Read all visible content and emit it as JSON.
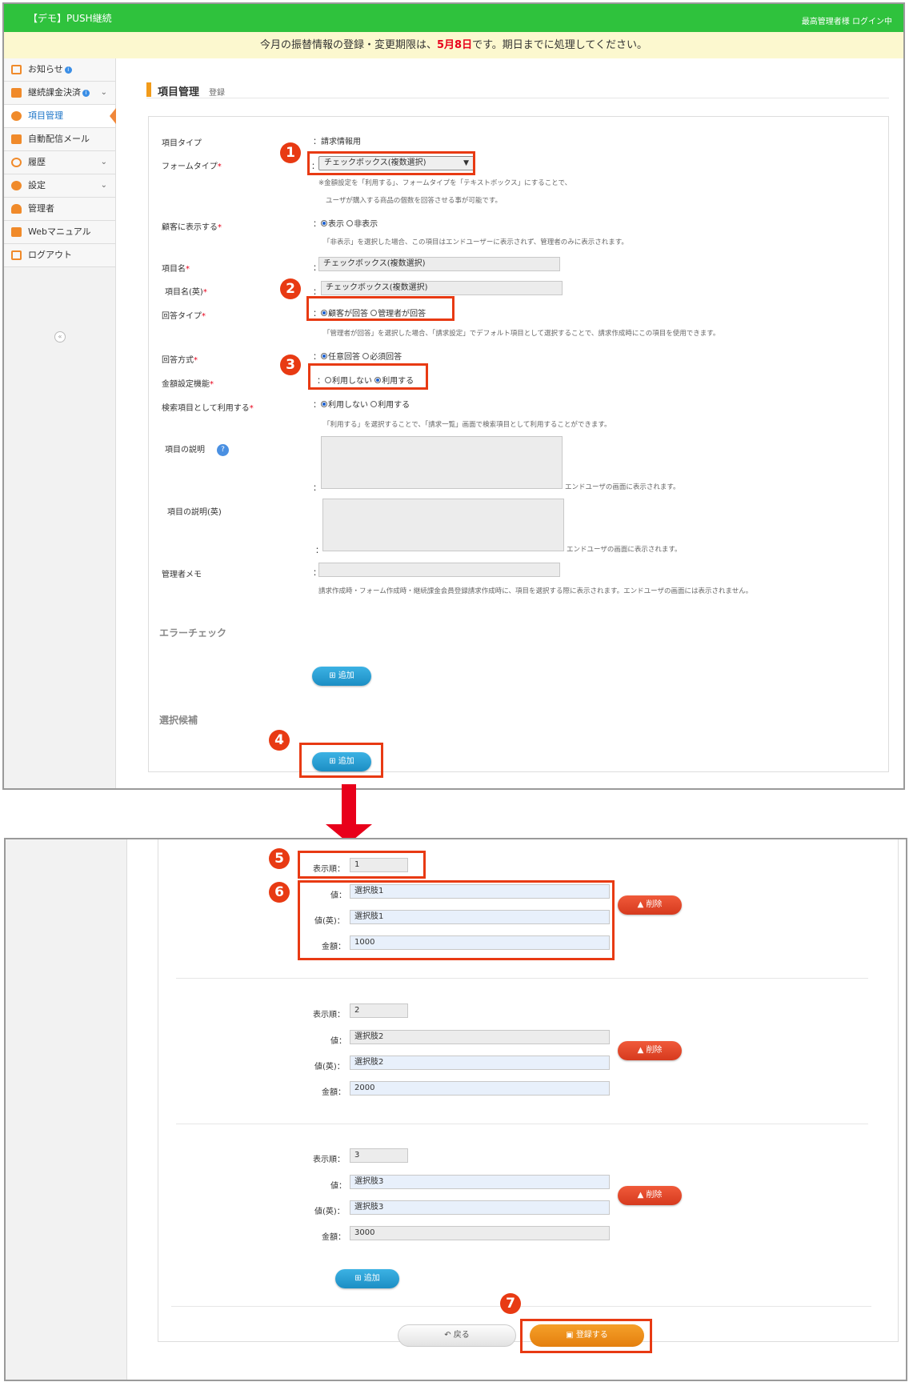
{
  "header": {
    "title": "【デモ】PUSH継続",
    "login": "最高管理者様 ログイン中"
  },
  "notice": {
    "before": "今月の振替情報の登録・変更期限は、",
    "date": "5月8日",
    "after": "です。期日までに処理してください。"
  },
  "sidebar": {
    "items": [
      {
        "label": "お知らせ",
        "icon": "chart-icon",
        "color": "#f08a2a"
      },
      {
        "label": "継続課金決済",
        "icon": "card-icon",
        "color": "#f08a2a"
      },
      {
        "label": "項目管理",
        "icon": "cubes-icon",
        "color": "#f08a2a"
      },
      {
        "label": "自動配信メール",
        "icon": "mail-icon",
        "color": "#f08a2a"
      },
      {
        "label": "履歴",
        "icon": "history-icon",
        "color": "#f08a2a"
      },
      {
        "label": "設定",
        "icon": "gears-icon",
        "color": "#f08a2a"
      },
      {
        "label": "管理者",
        "icon": "user-icon",
        "color": "#f08a2a"
      },
      {
        "label": "Webマニュアル",
        "icon": "book-icon",
        "color": "#f08a2a"
      },
      {
        "label": "ログアウト",
        "icon": "logout-icon",
        "color": "#f08a2a"
      }
    ],
    "info_mark": "i"
  },
  "page": {
    "title": "項目管理",
    "subtitle": "登録"
  },
  "form": {
    "item_type": {
      "label": "項目タイプ",
      "value": "：請求情報用"
    },
    "form_type": {
      "label": "フォームタイプ",
      "value": "チェックボックス(複数選択)",
      "note1": "※金額設定を「利用する」、フォームタイプを「テキストボックス」にすることで、",
      "note2": "ユーザが購入する商品の個数を回答させる事が可能です。"
    },
    "display": {
      "label": "顧客に表示する",
      "opt1": "表示",
      "opt2": "非表示",
      "note": "「非表示」を選択した場合、この項目はエンドユーザーに表示されず、管理者のみに表示されます。"
    },
    "name": {
      "label": "項目名",
      "value": "チェックボックス(複数選択)"
    },
    "name_en": {
      "label": "項目名(英)",
      "value": "チェックボックス(複数選択)"
    },
    "answer_type": {
      "label": "回答タイプ",
      "opt1": "顧客が回答",
      "opt2": "管理者が回答",
      "note": "「管理者が回答」を選択した場合、「請求設定」でデフォルト項目として選択することで、請求作成時にこの項目を使用できます。"
    },
    "answer_method": {
      "label": "回答方式",
      "opt1": "任意回答",
      "opt2": "必須回答"
    },
    "amount": {
      "label": "金額設定機能",
      "opt1": "利用しない",
      "opt2": "利用する"
    },
    "search": {
      "label": "検索項目として利用する",
      "opt1": "利用しない",
      "opt2": "利用する",
      "note": "「利用する」を選択することで、「請求一覧」画面で検索項目として利用することができます。"
    },
    "desc": {
      "label": "項目の説明",
      "note": "エンドユーザの画面に表示されます。",
      "help": "?"
    },
    "desc_en": {
      "label": "項目の説明(英)",
      "note": "エンドユーザの画面に表示されます。"
    },
    "memo": {
      "label": "管理者メモ",
      "note": "請求作成時・フォーム作成時・継続課金会員登録請求作成時に、項目を選択する際に表示されます。エンドユーザの画面には表示されません。"
    },
    "colon": "：",
    "req": "*"
  },
  "error_check": {
    "title": "エラーチェック",
    "add": "追加"
  },
  "choices": {
    "title": "選択候補",
    "add": "追加"
  },
  "badges": [
    "1",
    "2",
    "3",
    "4",
    "5",
    "6",
    "7"
  ],
  "options": {
    "labels": {
      "order": "表示順：",
      "value": "値：",
      "value_en": "値(英)：",
      "amount": "金額："
    },
    "delete": "削除",
    "add": "追加",
    "rows": [
      {
        "order": "1",
        "value": "選択肢1",
        "value_en": "選択肢1",
        "amount": "1000"
      },
      {
        "order": "2",
        "value": "選択肢2",
        "value_en": "選択肢2",
        "amount": "2000"
      },
      {
        "order": "3",
        "value": "選択肢3",
        "value_en": "選択肢3",
        "amount": "3000"
      }
    ]
  },
  "footer": {
    "back": "戻る",
    "register": "登録する"
  }
}
